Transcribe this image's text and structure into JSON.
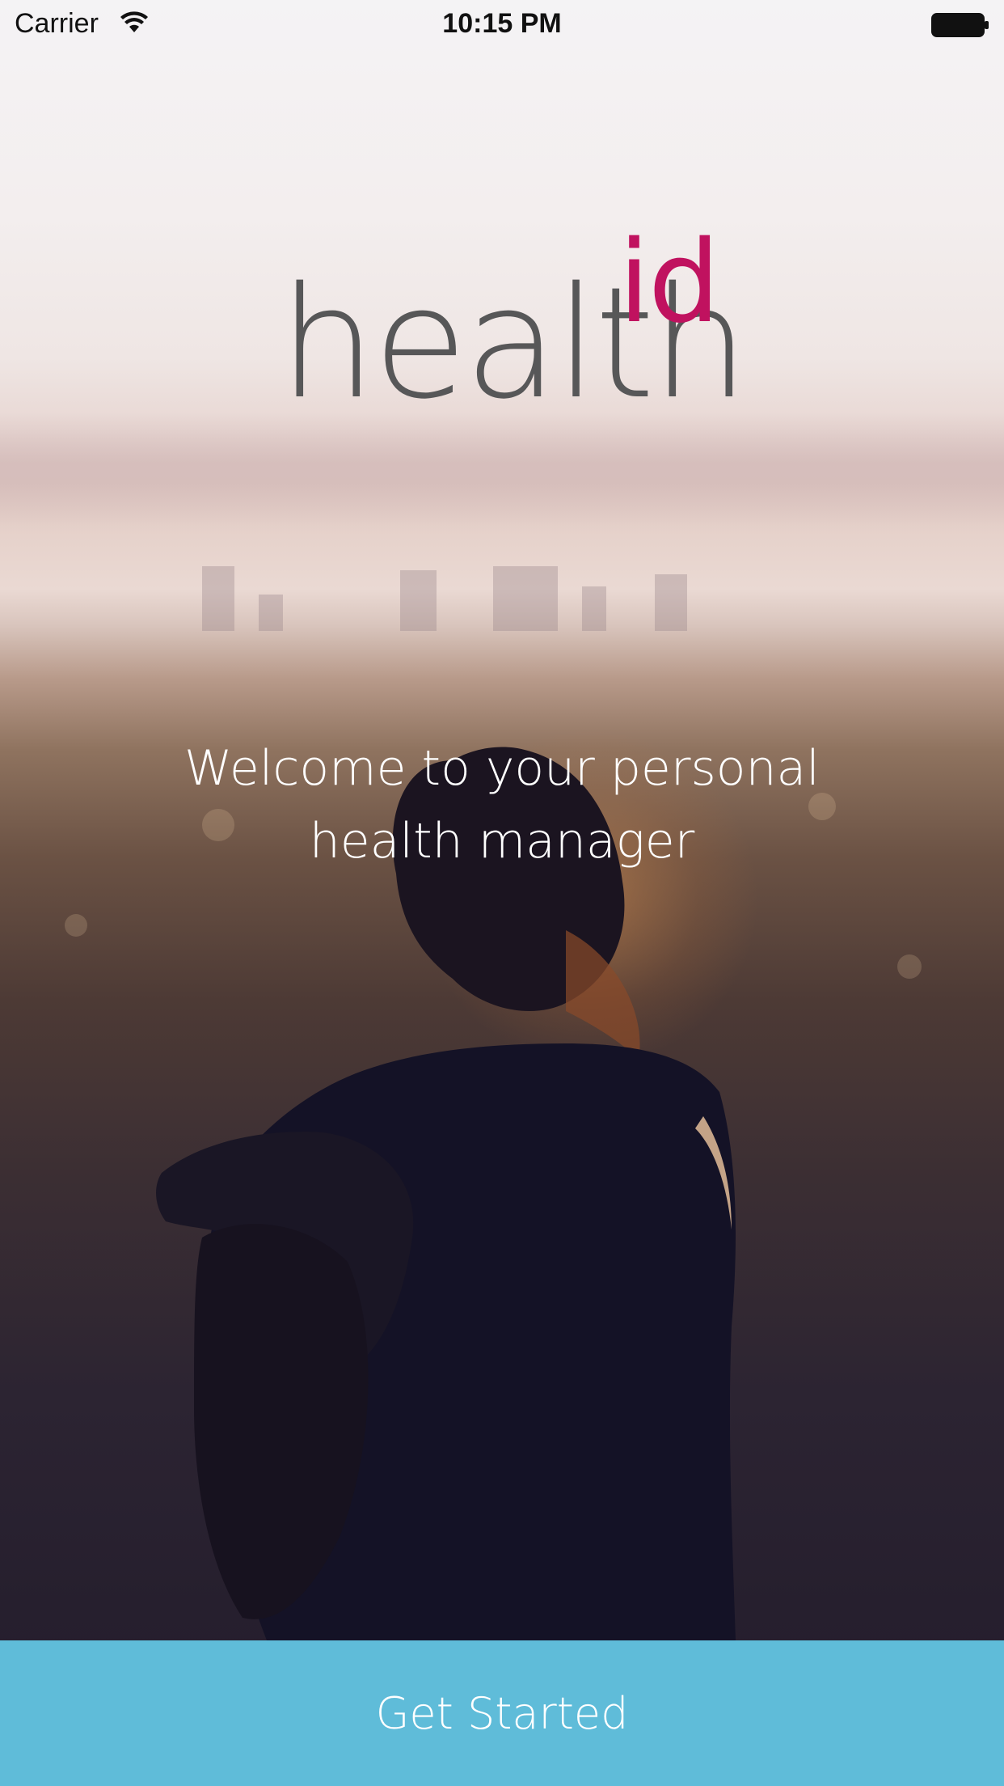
{
  "status_bar": {
    "carrier": "Carrier",
    "time": "10:15 PM",
    "wifi_icon": "wifi-icon",
    "battery_icon": "battery-icon"
  },
  "logo": {
    "word": "health",
    "suffix": "id",
    "word_color": "#575758",
    "suffix_color": "#c0125f"
  },
  "welcome": {
    "text": "Welcome to your personal health manager"
  },
  "cta": {
    "label": "Get Started",
    "color": "#5fbcd9"
  }
}
